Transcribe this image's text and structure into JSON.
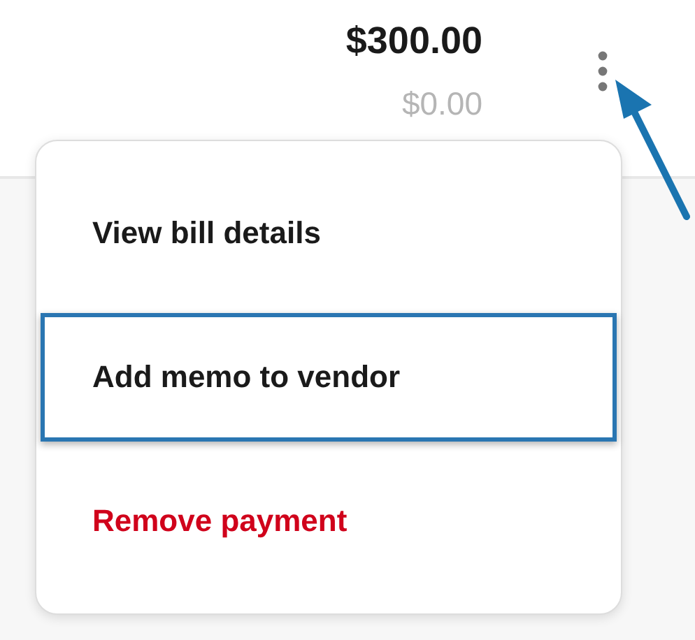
{
  "amount": "$300.00",
  "balance": "$0.00",
  "menu": [
    {
      "label": "View bill details",
      "kind": "default",
      "selected": false
    },
    {
      "label": "Add memo to vendor",
      "kind": "default",
      "selected": true
    },
    {
      "label": "Remove payment",
      "kind": "danger",
      "selected": false
    }
  ]
}
